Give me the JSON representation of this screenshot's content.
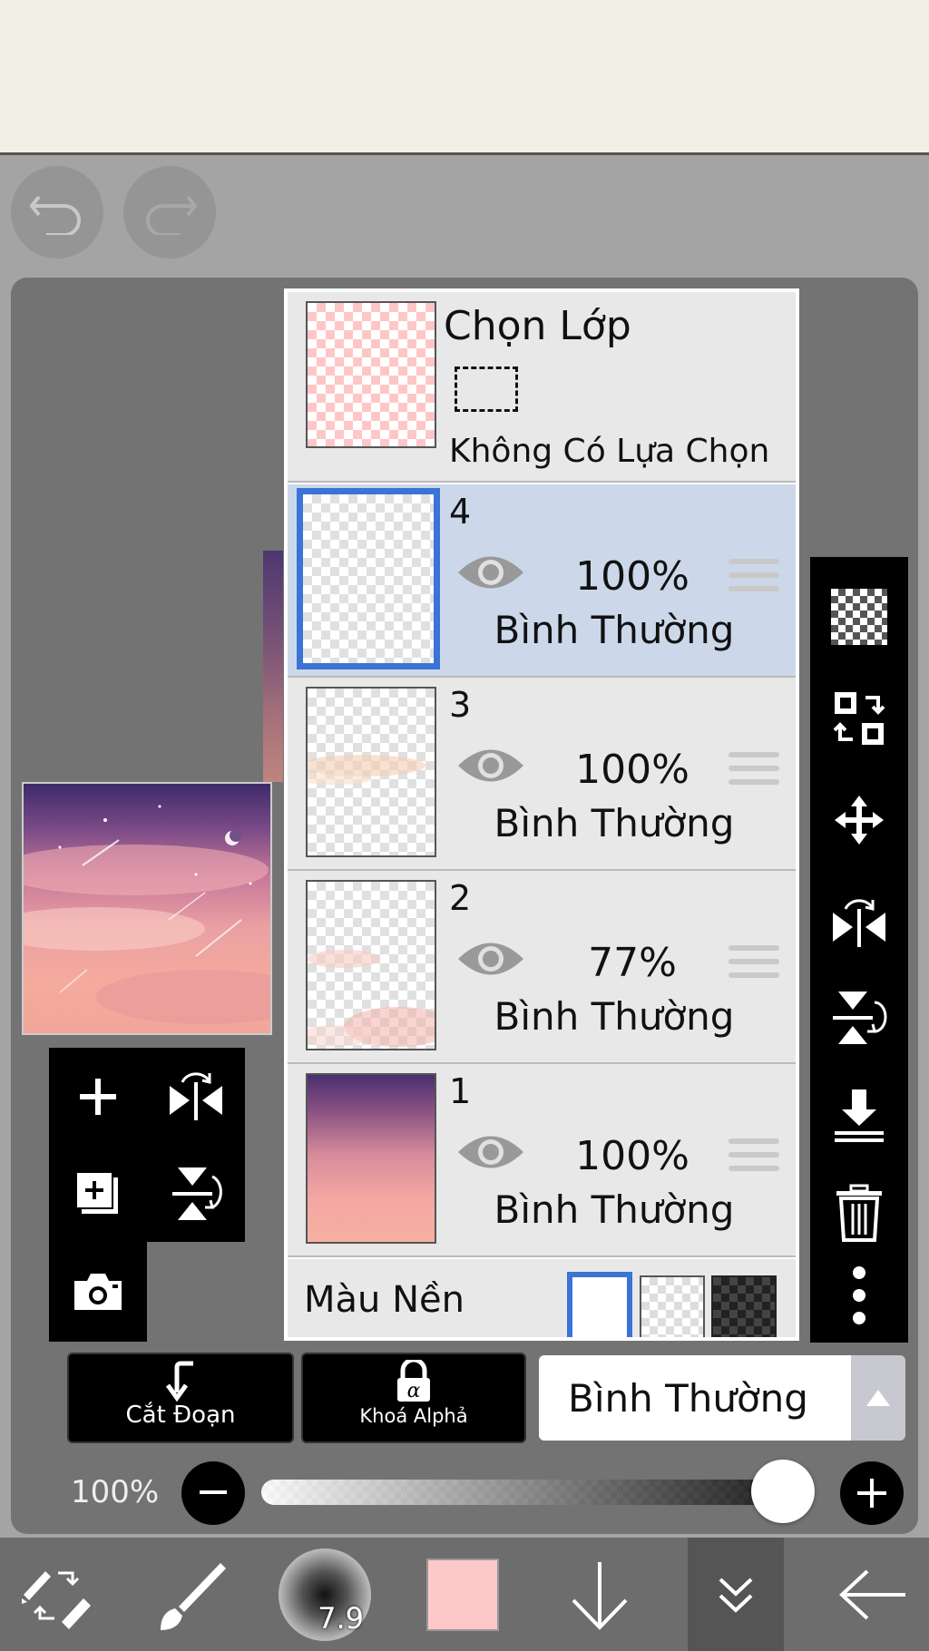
{
  "layers_panel": {
    "selection": {
      "title": "Chọn Lớp",
      "status": "Không Có Lựa Chọn"
    },
    "layers": [
      {
        "number": "4",
        "opacity": "100%",
        "blend": "Bình Thường",
        "selected": true
      },
      {
        "number": "3",
        "opacity": "100%",
        "blend": "Bình Thường",
        "selected": false
      },
      {
        "number": "2",
        "opacity": "77%",
        "blend": "Bình Thường",
        "selected": false
      },
      {
        "number": "1",
        "opacity": "100%",
        "blend": "Bình Thường",
        "selected": false
      }
    ],
    "background_label": "Màu Nền"
  },
  "bottom_controls": {
    "clip_label": "Cắt Đoạn",
    "alpha_lock_label": "Khoá Alphả",
    "blend_mode_value": "Bình Thường",
    "opacity_value": "100%",
    "opacity_fraction": 1.0
  },
  "toolbar": {
    "brush_size": "7.9",
    "current_color": "#ffc8c8"
  },
  "icons": [
    "undo-icon",
    "redo-icon",
    "add-layer-icon",
    "flip-horizontal-icon",
    "duplicate-layer-icon",
    "flip-vertical-icon",
    "camera-icon",
    "transparency-icon",
    "swap-layers-icon",
    "move-icon",
    "flip-h-icon",
    "flip-v-icon",
    "merge-down-icon",
    "trash-icon",
    "more-icon",
    "clip-icon",
    "alpha-lock-icon",
    "eye-icon",
    "tool-switch-icon",
    "brush-icon",
    "arrow-down-icon",
    "double-chevron-icon",
    "back-arrow-icon"
  ]
}
